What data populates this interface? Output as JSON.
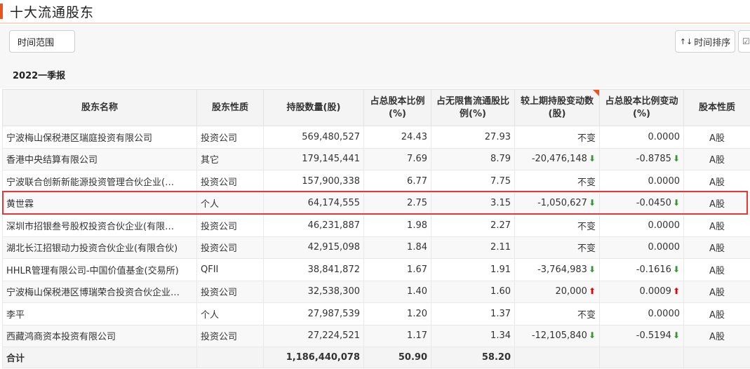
{
  "header": {
    "title": "十大流通股东"
  },
  "toolbar": {
    "range_label": "时间范围",
    "sort_icon": "↑↓",
    "sort_label": "时间排序",
    "export_icon": "☑"
  },
  "period": {
    "label": "2022一季报"
  },
  "table": {
    "columns": [
      "股东名称",
      "股东性质",
      "持股数量(股)",
      "占总股本比例(%)",
      "占无限售流通股比例(%)",
      "较上期持股变动数(股)",
      "占总股本比例变动(%)",
      "股本性质"
    ],
    "rows": [
      {
        "name": "宁波梅山保税港区瑞庭投资有限公司",
        "type": "投资公司",
        "shares": "569,480,527",
        "pct_total": "24.43",
        "pct_float": "27.93",
        "change": "不变",
        "change_dir": "none",
        "pct_change": "0.0000",
        "pct_change_dir": "none",
        "share_type": "A股"
      },
      {
        "name": "香港中央结算有限公司",
        "type": "其它",
        "shares": "179,145,441",
        "pct_total": "7.69",
        "pct_float": "8.79",
        "change": "-20,476,148",
        "change_dir": "down",
        "pct_change": "-0.8785",
        "pct_change_dir": "down",
        "share_type": "A股"
      },
      {
        "name": "宁波联合创新新能源投资管理合伙企业(…",
        "type": "投资公司",
        "shares": "157,900,338",
        "pct_total": "6.77",
        "pct_float": "7.75",
        "change": "不变",
        "change_dir": "none",
        "pct_change": "0.0000",
        "pct_change_dir": "none",
        "share_type": "A股"
      },
      {
        "name": "黄世霖",
        "type": "个人",
        "shares": "64,174,555",
        "pct_total": "2.75",
        "pct_float": "3.15",
        "change": "-1,050,627",
        "change_dir": "down",
        "pct_change": "-0.0450",
        "pct_change_dir": "down",
        "share_type": "A股"
      },
      {
        "name": "深圳市招银叁号股权投资合伙企业(有限…",
        "type": "投资公司",
        "shares": "46,231,887",
        "pct_total": "1.98",
        "pct_float": "2.27",
        "change": "不变",
        "change_dir": "none",
        "pct_change": "0.0000",
        "pct_change_dir": "none",
        "share_type": "A股"
      },
      {
        "name": "湖北长江招银动力投资合伙企业(有限合伙)",
        "type": "投资公司",
        "shares": "42,915,098",
        "pct_total": "1.84",
        "pct_float": "2.11",
        "change": "不变",
        "change_dir": "none",
        "pct_change": "0.0000",
        "pct_change_dir": "none",
        "share_type": "A股"
      },
      {
        "name": "HHLR管理有限公司-中国价值基金(交易所)",
        "type": "QFII",
        "shares": "38,841,872",
        "pct_total": "1.67",
        "pct_float": "1.91",
        "change": "-3,764,983",
        "change_dir": "down",
        "pct_change": "-0.1616",
        "pct_change_dir": "down",
        "share_type": "A股"
      },
      {
        "name": "宁波梅山保税港区博瑞荣合投资合伙企业…",
        "type": "投资公司",
        "shares": "32,538,300",
        "pct_total": "1.40",
        "pct_float": "1.60",
        "change": "20,000",
        "change_dir": "up",
        "pct_change": "0.0009",
        "pct_change_dir": "up",
        "share_type": "A股"
      },
      {
        "name": "李平",
        "type": "个人",
        "shares": "27,987,539",
        "pct_total": "1.20",
        "pct_float": "1.37",
        "change": "不变",
        "change_dir": "none",
        "pct_change": "0.0000",
        "pct_change_dir": "none",
        "share_type": "A股"
      },
      {
        "name": "西藏鸿商资本投资有限公司",
        "type": "投资公司",
        "shares": "27,224,521",
        "pct_total": "1.17",
        "pct_float": "1.34",
        "change": "-12,105,840",
        "change_dir": "down",
        "pct_change": "-0.5194",
        "pct_change_dir": "down",
        "share_type": "A股"
      }
    ],
    "total": {
      "label": "合计",
      "shares": "1,186,440,078",
      "pct_total": "50.90",
      "pct_float": "58.20"
    }
  },
  "icons": {
    "down": "arrow-down-icon",
    "up": "arrow-up-icon"
  },
  "colors": {
    "accent": "#e8541e",
    "down": "#2e9a2e",
    "up": "#e60000",
    "highlight": "#e53935"
  }
}
